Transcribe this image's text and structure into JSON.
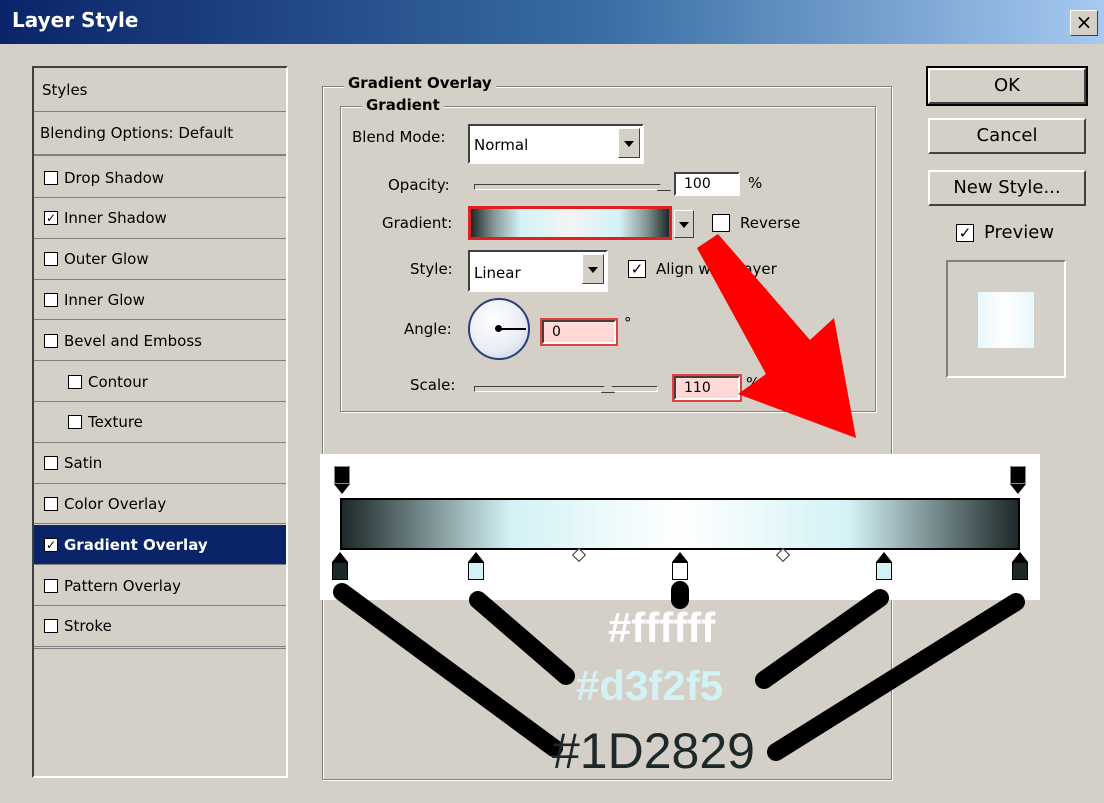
{
  "window": {
    "title": "Layer Style",
    "close_glyph": "×"
  },
  "styles_panel": {
    "header": "Styles",
    "blending_options": "Blending Options: Default",
    "items": [
      {
        "label": "Drop Shadow",
        "checked": false,
        "indent": false,
        "selected": false
      },
      {
        "label": "Inner Shadow",
        "checked": true,
        "indent": false,
        "selected": false
      },
      {
        "label": "Outer Glow",
        "checked": false,
        "indent": false,
        "selected": false
      },
      {
        "label": "Inner Glow",
        "checked": false,
        "indent": false,
        "selected": false
      },
      {
        "label": "Bevel and Emboss",
        "checked": false,
        "indent": false,
        "selected": false
      },
      {
        "label": "Contour",
        "checked": false,
        "indent": true,
        "selected": false
      },
      {
        "label": "Texture",
        "checked": false,
        "indent": true,
        "selected": false
      },
      {
        "label": "Satin",
        "checked": false,
        "indent": false,
        "selected": false
      },
      {
        "label": "Color Overlay",
        "checked": false,
        "indent": false,
        "selected": false
      },
      {
        "label": "Gradient Overlay",
        "checked": true,
        "indent": false,
        "selected": true
      },
      {
        "label": "Pattern Overlay",
        "checked": false,
        "indent": false,
        "selected": false
      },
      {
        "label": "Stroke",
        "checked": false,
        "indent": false,
        "selected": false
      }
    ]
  },
  "gradient_overlay": {
    "section_title": "Gradient Overlay",
    "group_title": "Gradient",
    "blend_mode_label": "Blend Mode:",
    "blend_mode_value": "Normal",
    "opacity_label": "Opacity:",
    "opacity_value": "100",
    "opacity_fraction": 1.0,
    "percent_unit": "%",
    "gradient_label": "Gradient:",
    "reverse_label": "Reverse",
    "reverse_checked": false,
    "style_label": "Style:",
    "style_value": "Linear",
    "align_label": "Align with Layer",
    "align_checked": true,
    "angle_label": "Angle:",
    "angle_value": "0",
    "degree_unit": "°",
    "scale_label": "Scale:",
    "scale_value": "110",
    "scale_fraction": 0.73
  },
  "buttons": {
    "ok": "OK",
    "cancel": "Cancel",
    "new_style": "New Style...",
    "preview_label": "Preview",
    "preview_checked": true
  },
  "gradient_editor": {
    "stops": [
      "#1D2829",
      "#d3f2f5",
      "#ffffff",
      "#d3f2f5",
      "#1D2829"
    ],
    "annotation_white": "#ffffff",
    "annotation_light": "#d3f2f5",
    "annotation_dark": "#1D2829"
  },
  "colors": {
    "selected_bg": "#0a246a",
    "arrow_red": "#ff0000",
    "dialog_bg": "#d4d0c8"
  }
}
